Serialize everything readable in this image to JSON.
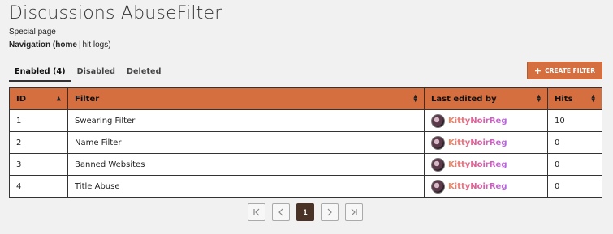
{
  "header": {
    "title": "Discussions AbuseFilter",
    "subtitle": "Special page",
    "nav_prefix": "Navigation (",
    "nav_home": "home",
    "nav_separator": "|",
    "nav_hit_logs": "hit logs",
    "nav_suffix": ")"
  },
  "tabs": [
    {
      "label": "Enabled (4)",
      "active": true
    },
    {
      "label": "Disabled",
      "active": false
    },
    {
      "label": "Deleted",
      "active": false
    }
  ],
  "create_button": {
    "label": "CREATE FILTER",
    "icon": "plus-icon",
    "color": "#d66f40"
  },
  "table": {
    "columns": [
      "ID",
      "Filter",
      "Last edited by",
      "Hits"
    ],
    "rows": [
      {
        "id": "1",
        "filter": "Swearing Filter",
        "editor": "KittyNoirReg",
        "hits": "10"
      },
      {
        "id": "2",
        "filter": "Name Filter",
        "editor": "KittyNoirReg",
        "hits": "0"
      },
      {
        "id": "3",
        "filter": "Banned Websites",
        "editor": "KittyNoirReg",
        "hits": "0"
      },
      {
        "id": "4",
        "filter": "Title Abuse",
        "editor": "KittyNoirReg",
        "hits": "0"
      }
    ],
    "header_color": "#d66f40"
  },
  "pagination": {
    "current_page": "1"
  }
}
